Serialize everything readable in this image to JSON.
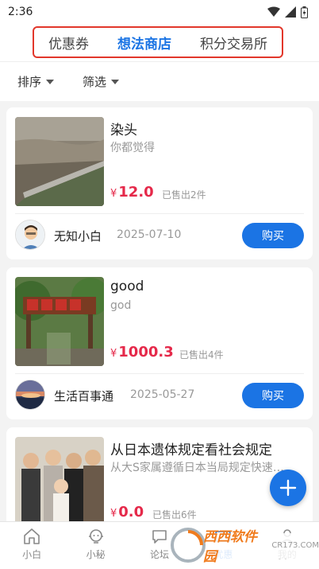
{
  "statusbar": {
    "time": "2:36"
  },
  "header": {
    "tabs": [
      {
        "label": "优惠券"
      },
      {
        "label": "想法商店"
      },
      {
        "label": "积分交易所"
      }
    ]
  },
  "filters": {
    "sort": "排序",
    "filter": "筛选"
  },
  "items": [
    {
      "title": "染头",
      "desc": "你都觉得",
      "currency": "¥",
      "price": "12.0",
      "sold": "已售出2件",
      "seller": "无知小白",
      "date": "2025-07-10",
      "buy": "购买"
    },
    {
      "title": "good",
      "desc": "god",
      "currency": "¥",
      "price": "1000.3",
      "sold": "已售出4件",
      "seller": "生活百事通",
      "date": "2025-05-27",
      "buy": "购买"
    },
    {
      "title": "从日本遗体规定看社会规定",
      "desc": "从大S家属遵循日本当局规定快速火化",
      "currency": "¥",
      "price": "0.0",
      "sold": "已售出6件"
    }
  ],
  "bottom_nav": [
    {
      "label": "小白",
      "icon": "home-icon"
    },
    {
      "label": "小秘",
      "icon": "assistant-icon"
    },
    {
      "label": "论坛",
      "icon": "forum-icon"
    },
    {
      "label": "优惠",
      "icon": "discount-icon"
    },
    {
      "label": "我的",
      "icon": "profile-icon"
    }
  ],
  "watermark": {
    "text": "西西软件园",
    "domain": "CR173.COM"
  },
  "colors": {
    "accent": "#1b74e4",
    "price": "#e5294a",
    "highlight_border": "#e2372b"
  }
}
